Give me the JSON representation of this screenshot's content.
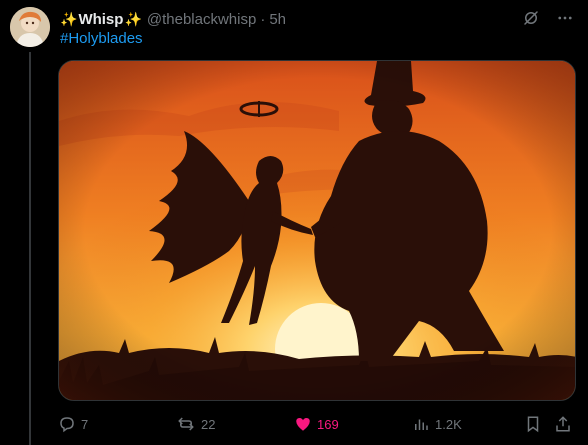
{
  "post": {
    "author": {
      "sparkle_left": "✨",
      "display_name": "Whisp",
      "sparkle_right": "✨",
      "handle": "@theblackwhisp",
      "separator": "·",
      "time": "5h"
    },
    "text": "#Holyblades",
    "top_icons": [
      "grok-icon",
      "more-icon"
    ],
    "media": {
      "icon": "silhouette-artwork",
      "colors": {
        "sky_top": "#e0561a",
        "sky_mid": "#f59a2a",
        "sun": "#fff3c4",
        "silhouette": "#2a0f08"
      }
    },
    "actions": {
      "reply_count": "7",
      "repost_count": "22",
      "like_count": "169",
      "views_count": "1.2K"
    },
    "colors": {
      "like_accent": "#f91880",
      "link": "#1d9bf0",
      "muted": "#71767b"
    }
  }
}
